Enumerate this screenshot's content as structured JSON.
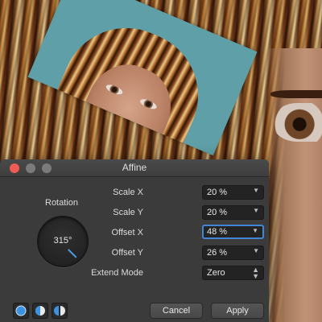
{
  "dialog": {
    "title": "Affine",
    "rotation_label": "Rotation",
    "rotation_value": "315°",
    "fields": [
      {
        "label": "Scale X",
        "value": "20 %"
      },
      {
        "label": "Scale Y",
        "value": "20 %"
      },
      {
        "label": "Offset X",
        "value": "48 %"
      },
      {
        "label": "Offset Y",
        "value": "26 %"
      },
      {
        "label": "Extend Mode",
        "value": "Zero"
      }
    ],
    "cancel_label": "Cancel",
    "apply_label": "Apply"
  },
  "colors": {
    "accent": "#3f86d4",
    "close": "#ee5c54",
    "dialog_bg": "#3b3b3b"
  },
  "icons": [
    "close-button-icon",
    "minimize-button-icon",
    "maximize-button-icon",
    "dropdown-caret-icon",
    "stepper-icon",
    "circle-mode-icon",
    "half-circle-mode-icon",
    "mirror-mode-icon"
  ]
}
